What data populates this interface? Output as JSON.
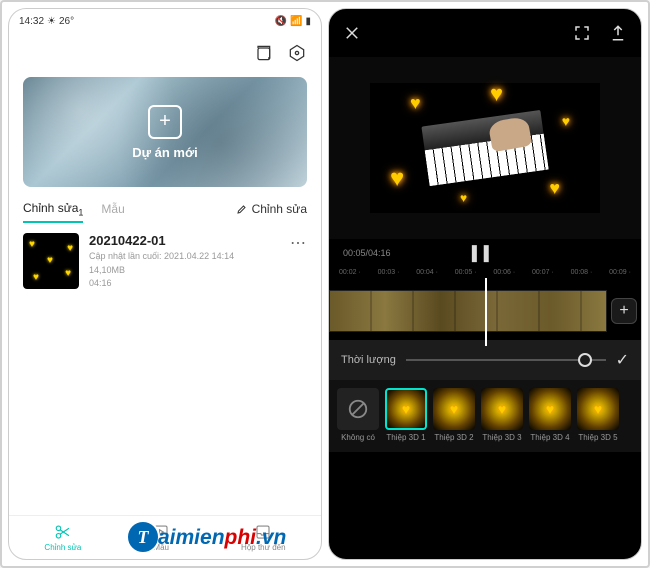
{
  "status": {
    "time": "14:32",
    "temp": "26°"
  },
  "hero": {
    "label": "Dự án mới"
  },
  "tabs": {
    "edit": "Chỉnh sửa",
    "edit_count": "1",
    "template": "Mẫu",
    "edit_btn": "Chỉnh sửa"
  },
  "project": {
    "title": "20210422-01",
    "updated": "Cập nhật lần cuối: 2021.04.22 14:14",
    "size": "14,10MB",
    "duration": "04:16"
  },
  "bottomnav": {
    "cut": "Chỉnh sửa",
    "template": "Mẫu",
    "inbox": "Hộp thư đến"
  },
  "watermark": {
    "letter": "T",
    "blue": "aimien",
    "red": "phi",
    "suffix": ".vn"
  },
  "editor": {
    "time": "00:05/04:16",
    "ruler": [
      "00:02",
      "00:03",
      "00:04",
      "00:05",
      "00:06",
      "00:07",
      "00:08",
      "00:09"
    ],
    "duration_label": "Thời lượng",
    "fx": [
      "Không có",
      "Thiệp 3D 1",
      "Thiệp 3D 2",
      "Thiệp 3D 3",
      "Thiệp 3D 4",
      "Thiệp 3D 5"
    ]
  }
}
